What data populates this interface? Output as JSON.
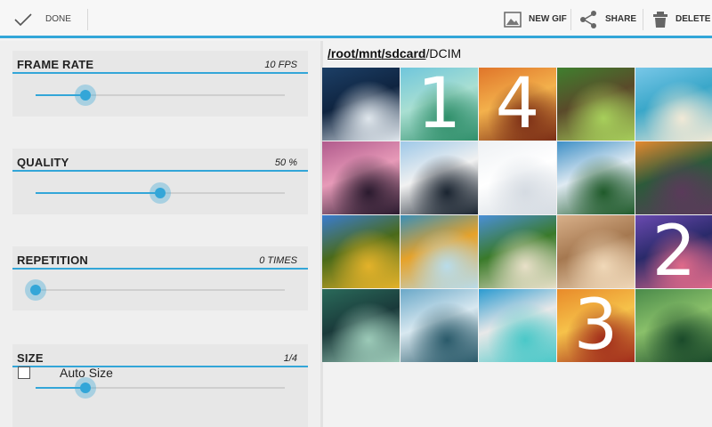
{
  "actionbar": {
    "done_label": "DONE",
    "new_gif_label": "NEW GIF",
    "share_label": "SHARE",
    "delete_label": "DELETE"
  },
  "settings": {
    "frame_rate": {
      "title": "FRAME RATE",
      "value": "10 FPS",
      "level": 0.2
    },
    "quality": {
      "title": "QUALITY",
      "value": "50 %",
      "level": 0.5
    },
    "repetition": {
      "title": "REPETITION",
      "value": "0 TIMES",
      "level": 0.0
    },
    "size": {
      "title": "SIZE",
      "value": "1/4",
      "level": 0.2,
      "auto_size_label": "Auto Size",
      "auto_size_checked": false
    }
  },
  "browser": {
    "path_segments": [
      "/root",
      "/mnt",
      "/sdcard"
    ],
    "path_current": "/DCIM"
  },
  "gallery": {
    "tiles": [
      {
        "icon": "glacier-coast-photo",
        "colors": [
          "#1c3f66",
          "#dfe6ec",
          "#0f2440"
        ],
        "number": ""
      },
      {
        "icon": "tropical-island-photo",
        "colors": [
          "#6fc6dc",
          "#2f8f6a",
          "#a9dfd2"
        ],
        "number": "1"
      },
      {
        "icon": "sunset-dunes-photo",
        "colors": [
          "#e0752a",
          "#7a2c15",
          "#f3b14c"
        ],
        "number": "4"
      },
      {
        "icon": "forest-path-photo",
        "colors": [
          "#3f7f2e",
          "#a7cf5b",
          "#5a4a2a"
        ],
        "number": ""
      },
      {
        "icon": "beach-umbrella-photo",
        "colors": [
          "#78c7e8",
          "#f1e9d6",
          "#3aa7c9"
        ],
        "number": ""
      },
      {
        "icon": "pink-lake-trees-photo",
        "colors": [
          "#b05a8c",
          "#2a1a2e",
          "#e79ab8"
        ],
        "number": ""
      },
      {
        "icon": "penguins-photo",
        "colors": [
          "#9ec8e8",
          "#1a2430",
          "#f1f1f1"
        ],
        "number": ""
      },
      {
        "icon": "arctic-fox-photo",
        "colors": [
          "#eef1f4",
          "#d5dbe2",
          "#ffffff"
        ],
        "number": ""
      },
      {
        "icon": "mountain-lake-photo",
        "colors": [
          "#3d8fc6",
          "#1f5a2a",
          "#dfeaf2"
        ],
        "number": ""
      },
      {
        "icon": "dramatic-sunset-photo",
        "colors": [
          "#e58a2f",
          "#5a3a5a",
          "#2c5a3a"
        ],
        "number": ""
      },
      {
        "icon": "sunflowers-photo",
        "colors": [
          "#3a7cd0",
          "#e3b22a",
          "#4a6a1a"
        ],
        "number": ""
      },
      {
        "icon": "water-droplets-photo",
        "colors": [
          "#3a8fb8",
          "#b9dcea",
          "#e6a22a"
        ],
        "number": ""
      },
      {
        "icon": "castle-photo",
        "colors": [
          "#4a8fd8",
          "#e8e0c8",
          "#3a7a2a"
        ],
        "number": ""
      },
      {
        "icon": "seashell-sand-photo",
        "colors": [
          "#d8b08a",
          "#f0d8b8",
          "#a57850"
        ],
        "number": ""
      },
      {
        "icon": "purple-sunset-photo",
        "colors": [
          "#6a4ab0",
          "#e06a8a",
          "#2a2a6a"
        ],
        "number": "2"
      },
      {
        "icon": "waterfall-photo",
        "colors": [
          "#2a6a5a",
          "#9ccab8",
          "#1a3a3a"
        ],
        "number": ""
      },
      {
        "icon": "floating-island-photo",
        "colors": [
          "#6aa8c8",
          "#2a5a6a",
          "#d8e8f0"
        ],
        "number": ""
      },
      {
        "icon": "lagoon-photo",
        "colors": [
          "#2a9ad0",
          "#4ac8c8",
          "#e8e8e8"
        ],
        "number": ""
      },
      {
        "icon": "junk-boat-photo",
        "colors": [
          "#e88a2a",
          "#a02a1a",
          "#f6c24a"
        ],
        "number": "3"
      },
      {
        "icon": "green-rocks-photo",
        "colors": [
          "#4a8a4a",
          "#1a4a2a",
          "#8ac06a"
        ],
        "number": ""
      }
    ]
  }
}
